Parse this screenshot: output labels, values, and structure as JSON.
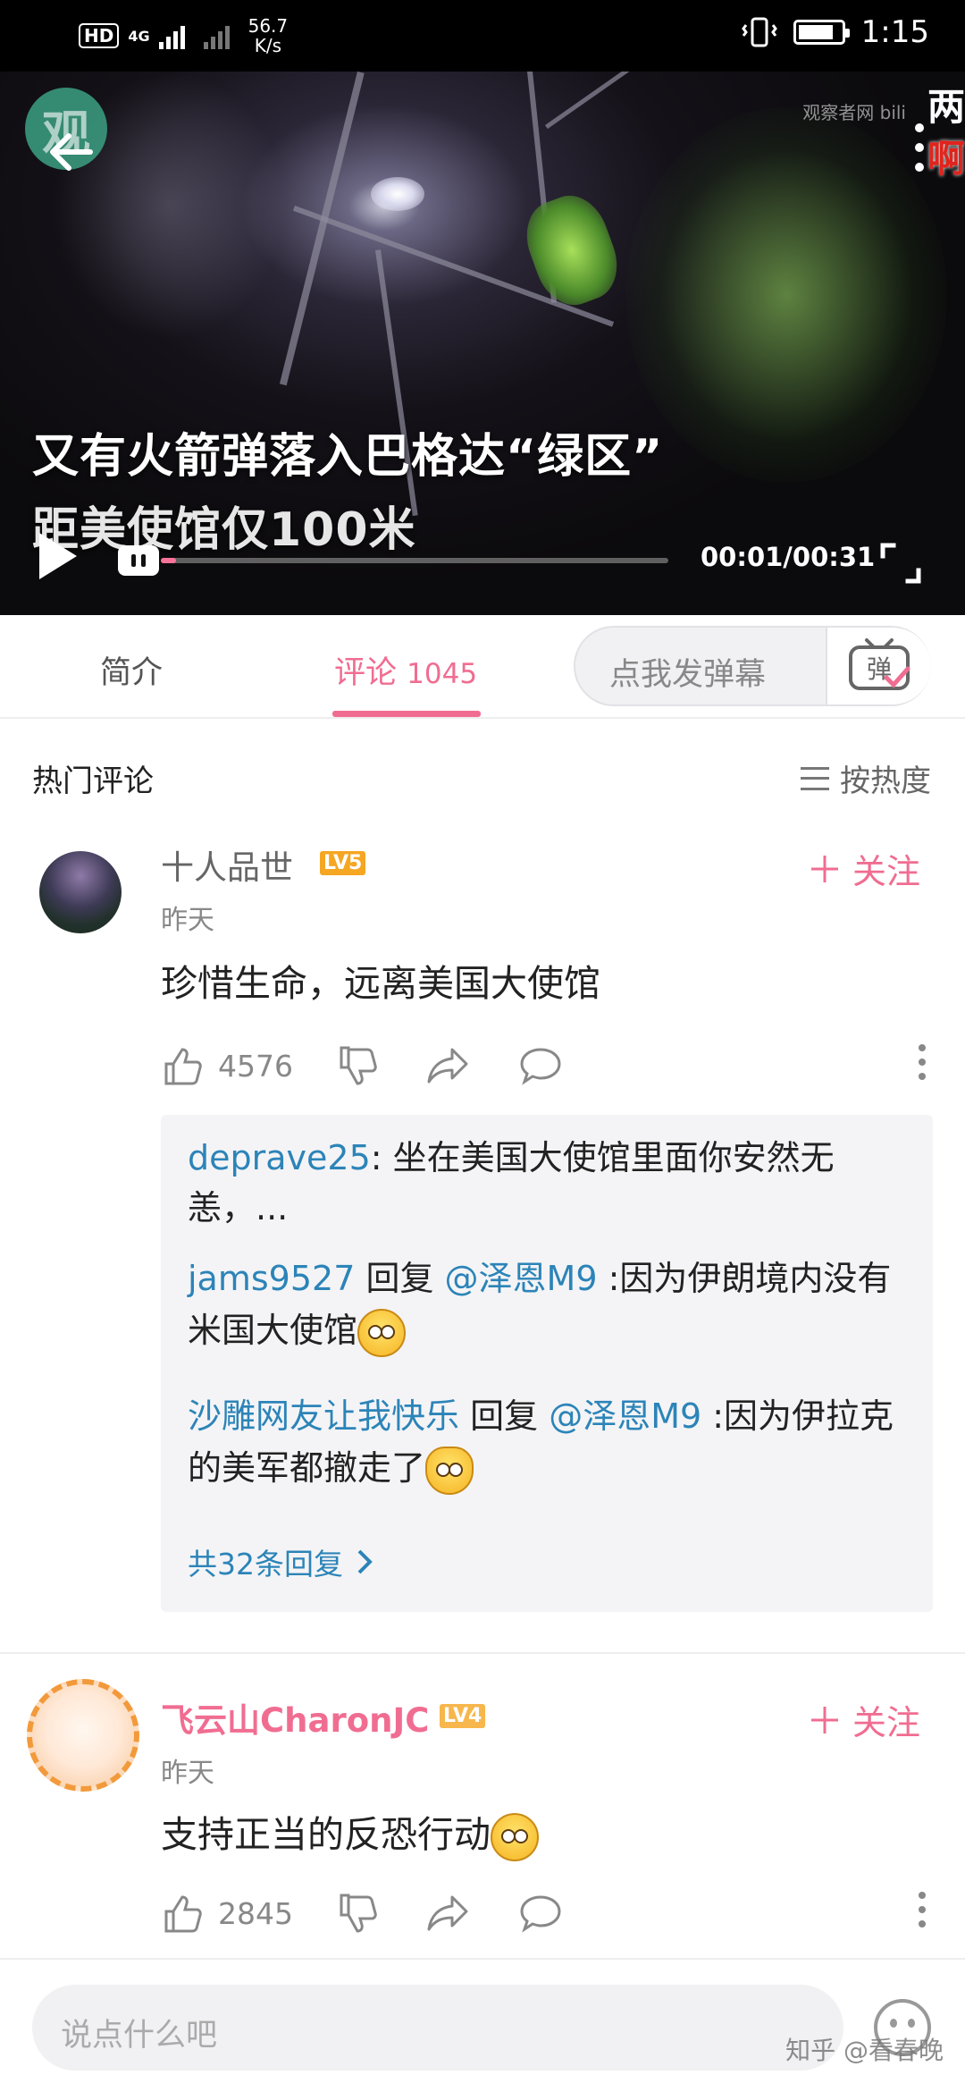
{
  "status_bar": {
    "hd": "HD",
    "network": "4G",
    "speed_value": "56.7",
    "speed_unit": "K/s",
    "time": "1:15",
    "battery_level": 0.85
  },
  "video": {
    "logo": "观",
    "watermark": "观察者网 bili",
    "danmaku": [
      "两",
      "啊"
    ],
    "caption_line1": "又有火箭弹落入巴格达“绿区”",
    "caption_line2": "距美使馆仅100米",
    "time": "00:01/00:31",
    "progress": 0.03
  },
  "tabs": {
    "intro": "简介",
    "comments": "评论",
    "comment_count": "1045",
    "danmaku_placeholder": "点我发弹幕",
    "danmaku_button": "弹"
  },
  "section": {
    "title": "热门评论",
    "sort": "按热度"
  },
  "comments": [
    {
      "name": "十人品世",
      "level": "LV5",
      "time": "昨天",
      "text": "珍惜生命，远离美国大使馆",
      "likes": "4576",
      "follow": "关注"
    },
    {
      "name": "飞云山CharonJC",
      "level": "LV4",
      "time": "昨天",
      "text": "支持正当的反恐行动",
      "likes": "2845",
      "follow": "关注"
    }
  ],
  "replies": [
    {
      "user": "deprave25",
      "sep": ": ",
      "text": "坐在美国大使馆里面你安然无恙，..."
    },
    {
      "user": "jams9527",
      "verb": " 回复 ",
      "mention": "@泽恩M9",
      "text": " :因为伊朗境内没有米国大使馆"
    },
    {
      "user": "沙雕网友让我快乐",
      "verb": " 回复 ",
      "mention": "@泽恩M9",
      "text": " :因为伊拉克的美军都撤走了"
    }
  ],
  "replies_more": "共32条回复",
  "bottom": {
    "placeholder": "说点什么吧",
    "watermark": "知乎 @看春晚"
  },
  "colors": {
    "accent": "#f06d91",
    "link": "#2c84b8",
    "level5": "#f5a623",
    "level4": "#f7b74d"
  }
}
